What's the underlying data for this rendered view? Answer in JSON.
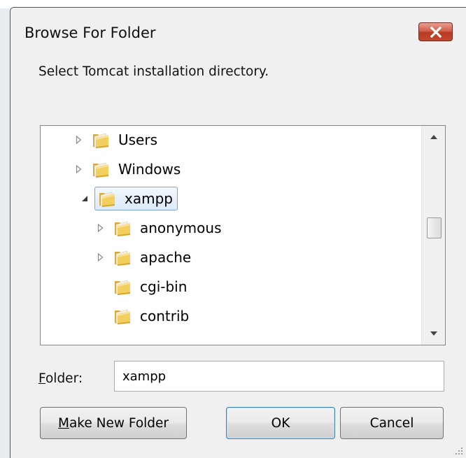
{
  "dialog": {
    "title": "Browse For Folder",
    "prompt": "Select Tomcat installation directory.",
    "close_icon": "close-x-icon"
  },
  "tree": {
    "items": [
      {
        "label": "Users",
        "expander": "collapsed",
        "selected": false
      },
      {
        "label": "Windows",
        "expander": "collapsed",
        "selected": false
      },
      {
        "label": "xampp",
        "expander": "expanded",
        "selected": true
      },
      {
        "label": "anonymous",
        "expander": "collapsed",
        "selected": false
      },
      {
        "label": "apache",
        "expander": "collapsed",
        "selected": false
      },
      {
        "label": "cgi-bin",
        "expander": "none",
        "selected": false
      },
      {
        "label": "contrib",
        "expander": "none",
        "selected": false
      }
    ],
    "scroll_position": 0.45
  },
  "folder_field": {
    "label_accel": "F",
    "label_rest": "older:",
    "value": "xampp"
  },
  "buttons": {
    "make_new_folder_accel": "M",
    "make_new_folder_rest": "ake New Folder",
    "ok": "OK",
    "cancel": "Cancel"
  },
  "colors": {
    "accent": "#3c7fb1",
    "selection_border": "#7da2ce",
    "close_button": "#c2492f"
  }
}
